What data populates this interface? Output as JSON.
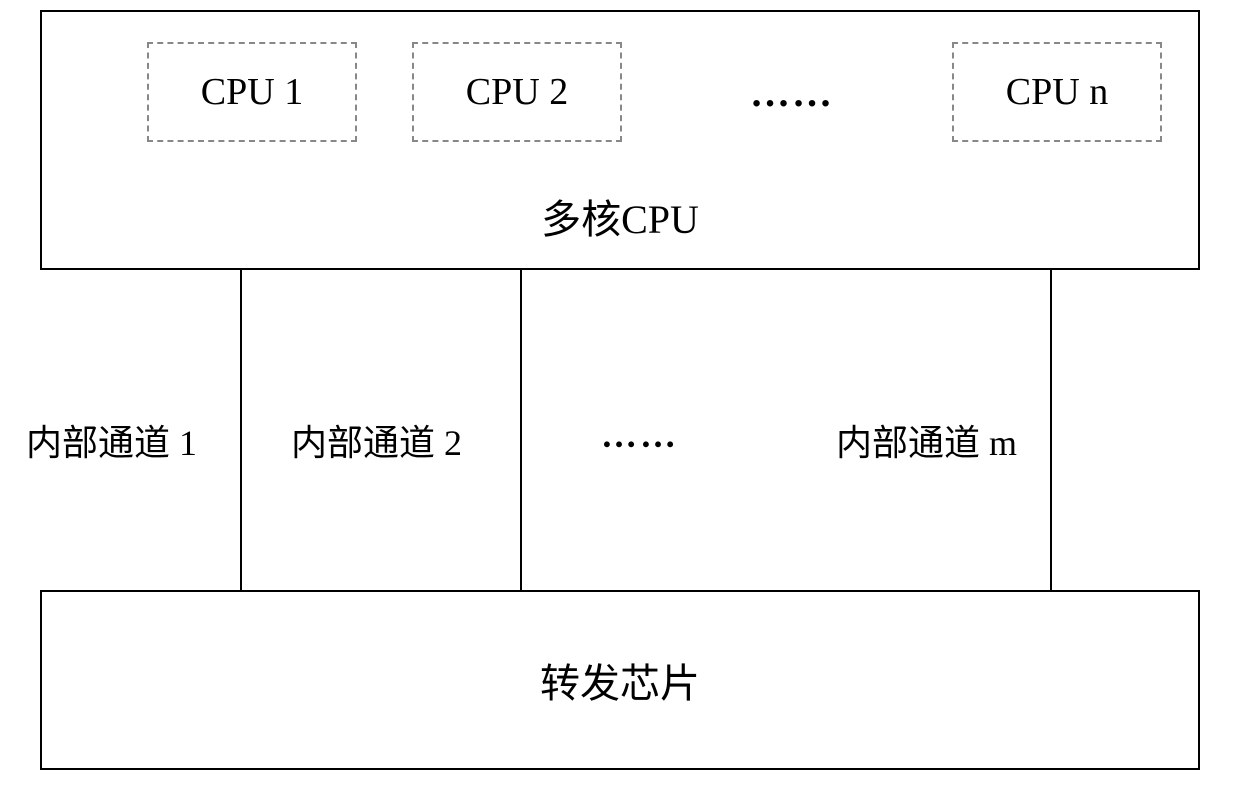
{
  "diagram": {
    "top_box": {
      "title": "多核CPU",
      "cores": {
        "cpu1": "CPU 1",
        "cpu2": "CPU 2",
        "dots": "……",
        "cpun": "CPU n"
      }
    },
    "channels": {
      "ch1": "内部通道 1",
      "ch2": "内部通道 2",
      "dots": "……",
      "chm": "内部通道 m"
    },
    "bottom_box": {
      "title": "转发芯片"
    }
  }
}
